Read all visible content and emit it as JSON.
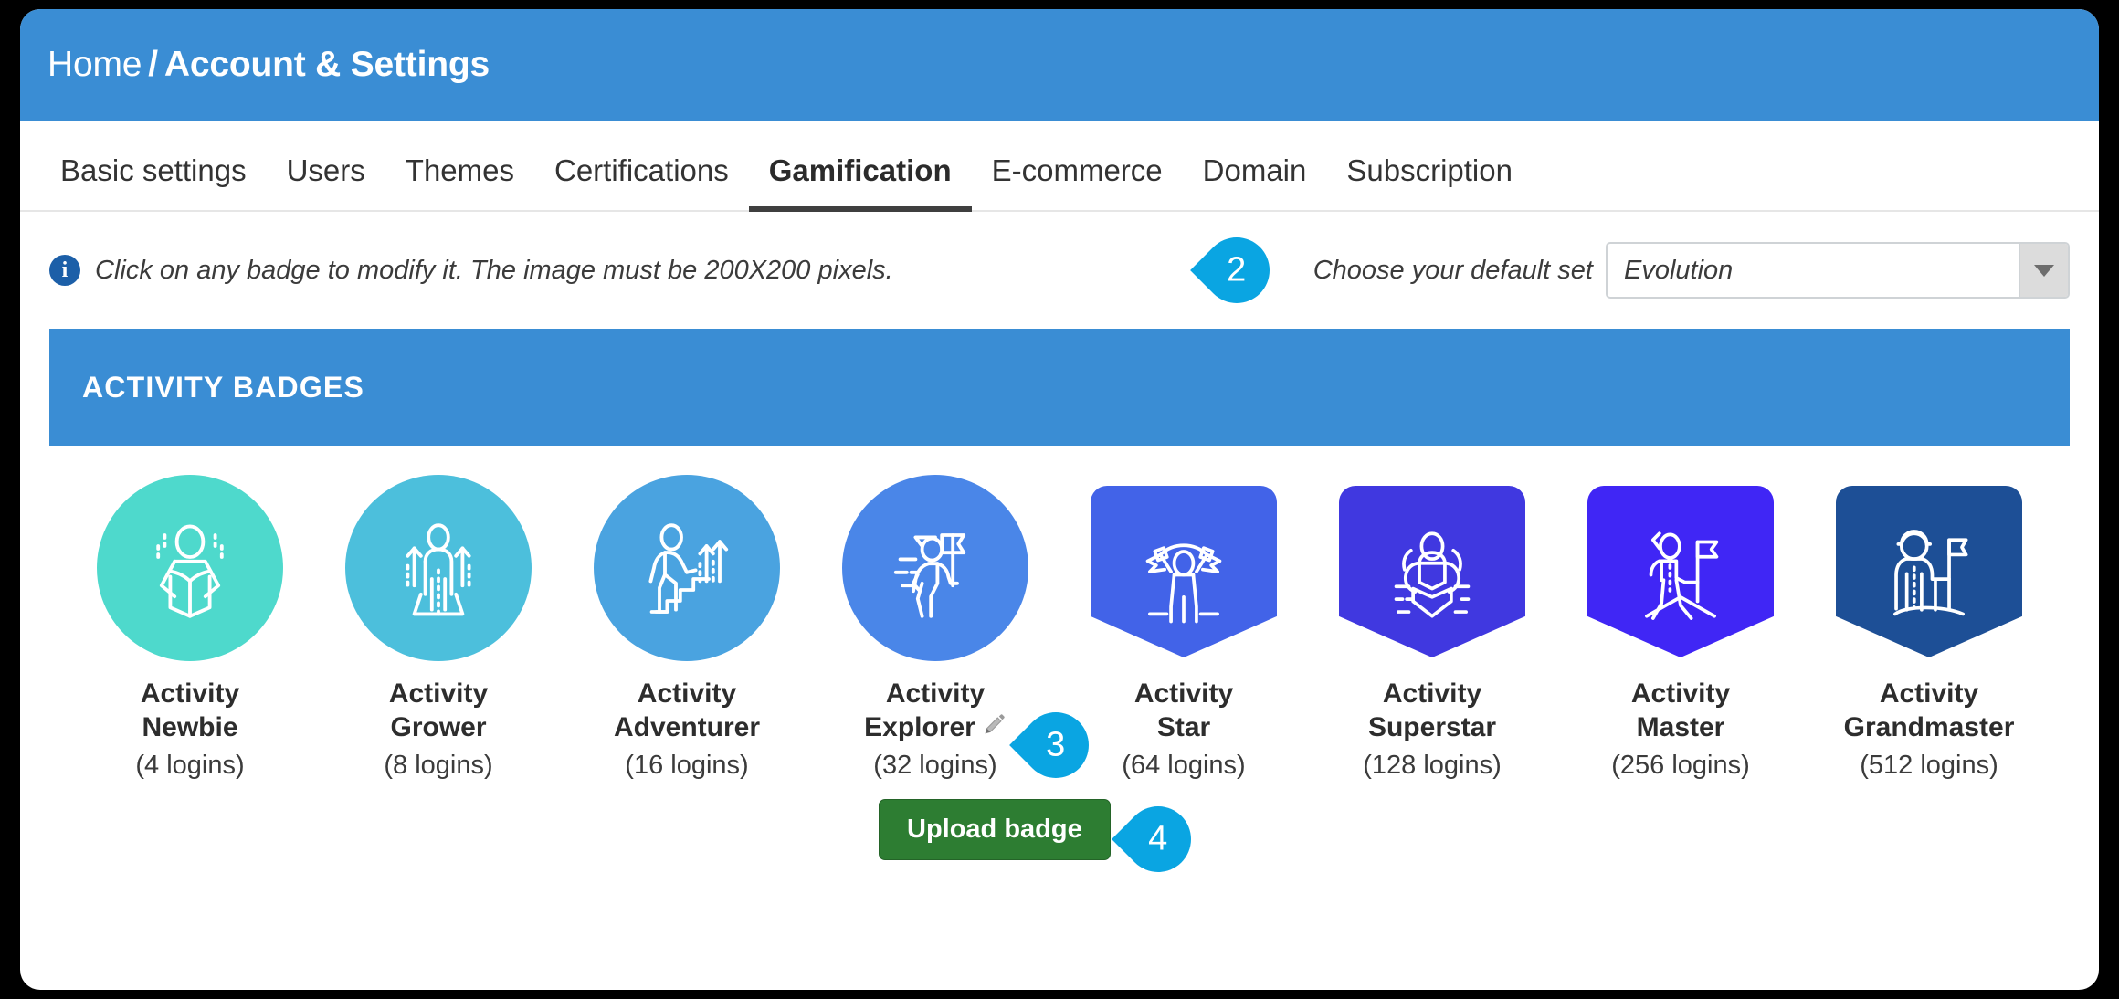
{
  "header": {
    "breadcrumb_home": "Home",
    "breadcrumb_separator": "/",
    "breadcrumb_current": "Account & Settings",
    "bar_color": "#3a8dd4"
  },
  "tabs": [
    {
      "label": "Basic settings",
      "active": false
    },
    {
      "label": "Users",
      "active": false
    },
    {
      "label": "Themes",
      "active": false
    },
    {
      "label": "Certifications",
      "active": false
    },
    {
      "label": "Gamification",
      "active": true
    },
    {
      "label": "E-commerce",
      "active": false
    },
    {
      "label": "Domain",
      "active": false
    },
    {
      "label": "Subscription",
      "active": false
    }
  ],
  "info": {
    "icon": "info-circle-icon",
    "text": "Click on any badge to modify it. The image must be 200X200 pixels."
  },
  "default_set": {
    "label": "Choose your default set",
    "value": "Evolution",
    "caret_icon": "chevron-down-icon"
  },
  "callouts": {
    "two": "2",
    "three": "3",
    "four": "4",
    "color": "#0aa5e2"
  },
  "section": {
    "title": "ACTIVITY BADGES"
  },
  "badges": [
    {
      "name_line1": "Activity",
      "name_line2": "Newbie",
      "count": "(4 logins)",
      "color": "#4ed9cc",
      "shape": "circle",
      "icon": "badge-reader-icon",
      "editable": false
    },
    {
      "name_line1": "Activity",
      "name_line2": "Grower",
      "count": "(8 logins)",
      "color": "#4cbfdc",
      "shape": "circle",
      "icon": "badge-growth-icon",
      "editable": false
    },
    {
      "name_line1": "Activity",
      "name_line2": "Adventurer",
      "count": "(16 logins)",
      "color": "#4aa3e0",
      "shape": "circle",
      "icon": "badge-stairs-icon",
      "editable": false
    },
    {
      "name_line1": "Activity",
      "name_line2": "Explorer",
      "count": "(32 logins)",
      "color": "#4a86e8",
      "shape": "circle",
      "icon": "badge-flagwalk-icon",
      "editable": true
    },
    {
      "name_line1": "Activity",
      "name_line2": "Star",
      "count": "(64 logins)",
      "color": "#4263e8",
      "shape": "shield",
      "icon": "badge-victory-icon",
      "editable": false
    },
    {
      "name_line1": "Activity",
      "name_line2": "Superstar",
      "count": "(128 logins)",
      "color": "#4038e0",
      "shape": "shield",
      "icon": "badge-strength-icon",
      "editable": false
    },
    {
      "name_line1": "Activity",
      "name_line2": "Master",
      "count": "(256 logins)",
      "color": "#4026f5",
      "shape": "shield",
      "icon": "badge-summitflag-icon",
      "editable": false
    },
    {
      "name_line1": "Activity",
      "name_line2": "Grandmaster",
      "count": "(512 logins)",
      "color": "#1d4f96",
      "shape": "shield",
      "icon": "badge-grandflag-icon",
      "editable": false
    }
  ],
  "upload": {
    "label": "Upload badge",
    "color": "#2d7d32"
  }
}
